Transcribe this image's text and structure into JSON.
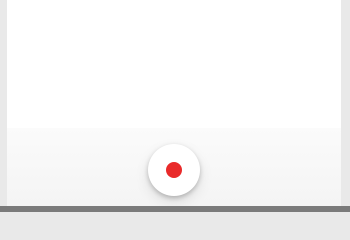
{
  "recorder": {
    "record_icon": "record-dot-icon",
    "record_color": "#e92a2a"
  }
}
